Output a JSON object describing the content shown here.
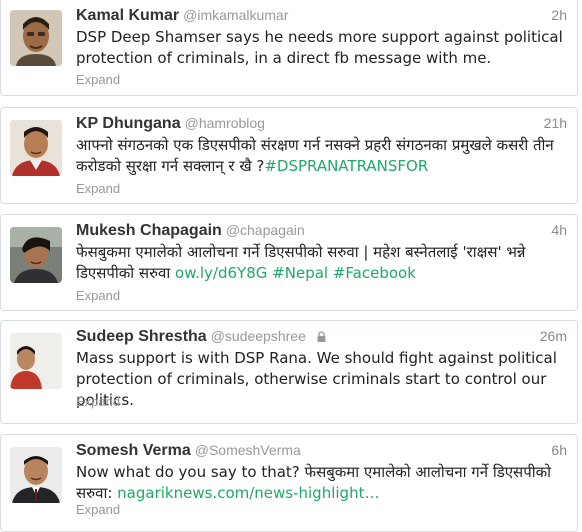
{
  "tweets": [
    {
      "name": "Kamal Kumar",
      "handle": "@imkamalkumar",
      "time": "2h",
      "text": "DSP Deep Shamser says he needs more support against political protection of criminals, in a direct fb message with me.",
      "expand": "Expand"
    },
    {
      "name": "KP Dhungana",
      "handle": "@hamroblog",
      "time": "21h",
      "text": "आफ्नो संगठनको एक डिएसपीको संरक्षण गर्न नसक्ने प्रहरी संगठनका प्रमुखले कसरी तीन करोडको सुरक्षा गर्न सक्लान् र खै ?",
      "hashtag": "#DSPRANATRANSFOR",
      "expand": "Expand"
    },
    {
      "name": "Mukesh Chapagain",
      "handle": "@chapagain",
      "time": "4h",
      "text": "फेसबुकमा एमालेको आलोचना गर्ने डिएसपीको सरुवा | महेश बस्नेतलाई 'राक्षस' भन्ने डिएसपीको सरुवा",
      "link": "ow.ly/d6Y8G",
      "hashtag1": "#Nepal",
      "hashtag2": "#Facebook",
      "expand": "Expand"
    },
    {
      "name": "Sudeep Shrestha",
      "handle": "@sudeepshree",
      "time": "26m",
      "text": "Mass support is with DSP Rana. We should fight against political protection of criminals, otherwise criminals start to control our politics.",
      "expand": "Expand"
    },
    {
      "name": "Somesh Verma",
      "handle": "@SomeshVerma",
      "time": "6h",
      "text": "Now what do you say to that? फेसबुकमा एमालेको आलोचना गर्ने डिएसपीको सरुवा:",
      "link": "nagariknews.com/news-highlight…",
      "expand": "Expand"
    }
  ],
  "colors": {
    "name": "#333333",
    "handle": "#999999",
    "link": "#20a86a",
    "border": "#d9dde2"
  }
}
